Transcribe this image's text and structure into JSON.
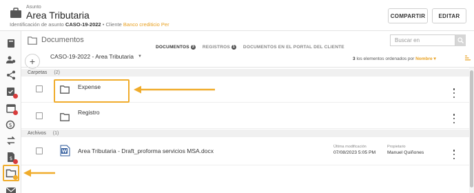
{
  "header": {
    "subject_label": "Asunto",
    "title": "Area Tributaria",
    "id_label": "Identificación de asunto",
    "case_id": "CASO-19-2022",
    "separator": "•",
    "client_label": "Cliente",
    "client_name": "Banco crediticio Per",
    "share_button": "COMPARTIR",
    "edit_button": "EDITAR"
  },
  "documents": {
    "title": "Documentos",
    "search_placeholder": "Buscar en",
    "tabs": [
      {
        "label": "DOCUMENTOS",
        "count": "3",
        "active": true
      },
      {
        "label": "REGISTROS",
        "count": "1",
        "active": false
      },
      {
        "label": "DOCUMENTOS EN EL PORTAL DEL CLIENTE",
        "count": "",
        "active": false
      }
    ],
    "breadcrumb": "CASO-19-2022 - Area Tributaria",
    "sort_count": "3",
    "sort_text": "los elementos ordenados por",
    "sort_field": "Nombre",
    "sections": {
      "folders_label": "Carpetas",
      "folders_count": "(2)",
      "files_label": "Archivos",
      "files_count": "(1)"
    },
    "folders": [
      {
        "name": "Expense"
      },
      {
        "name": "Registro"
      }
    ],
    "files": [
      {
        "name": "Area Tributaria - Draft_proforma servicios MSA.docx",
        "modified_label": "Última modificación",
        "modified_value": "07/08/2023 5:05 PM",
        "owner_label": "Propietario",
        "owner_value": "Manuel Quiñones"
      }
    ]
  },
  "colors": {
    "accent": "#f0ac2b",
    "link": "#e8a020",
    "word_blue": "#2b579a",
    "badge_red": "#d83b3b"
  },
  "rail_icons": [
    "book-icon",
    "users-icon",
    "share-icon",
    "checklist-icon",
    "calendar-icon",
    "billing-icon",
    "transfer-icon",
    "document-money-icon",
    "folder-docs-icon",
    "mail-icon"
  ]
}
